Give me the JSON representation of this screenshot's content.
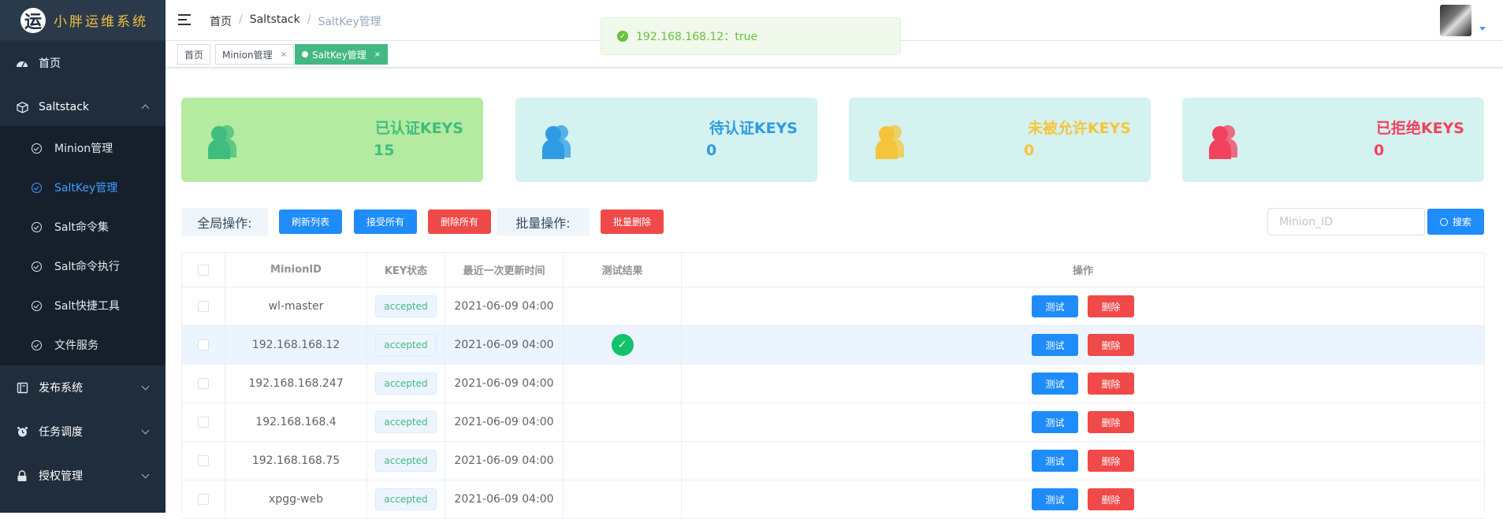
{
  "app": {
    "logo_char": "运",
    "logo_text": "小胖运维系统"
  },
  "sidebar": {
    "items": [
      {
        "label": "首页",
        "icon": "dashboard-icon"
      },
      {
        "label": "Saltstack",
        "icon": "box-icon"
      },
      {
        "label": "发布系统",
        "icon": "book-icon"
      },
      {
        "label": "任务调度",
        "icon": "alarm-icon"
      },
      {
        "label": "授权管理",
        "icon": "lock-icon"
      }
    ],
    "submenu": [
      {
        "label": "Minion管理"
      },
      {
        "label": "SaltKey管理",
        "active": true
      },
      {
        "label": "Salt命令集"
      },
      {
        "label": "Salt命令执行"
      },
      {
        "label": "Salt快捷工具"
      },
      {
        "label": "文件服务"
      }
    ]
  },
  "header": {
    "breadcrumb": [
      "首页",
      "Saltstack",
      "SaltKey管理"
    ]
  },
  "tags": [
    {
      "label": "首页"
    },
    {
      "label": "Minion管理",
      "close": "×"
    },
    {
      "label": "SaltKey管理",
      "close": "×",
      "active": true
    }
  ],
  "toast": {
    "message": "192.168.168.12：true",
    "color": "#67c23a"
  },
  "cards": [
    {
      "title": "已认证KEYS",
      "value": "15",
      "color": "#3fbd7f",
      "bg": "#b4eba0"
    },
    {
      "title": "待认证KEYS",
      "value": "0",
      "color": "#2f9be3",
      "bg": "#d4f2ef"
    },
    {
      "title": "未被允许KEYS",
      "value": "0",
      "color": "#f5c43b",
      "bg": "#d4f2ef"
    },
    {
      "title": "已拒绝KEYS",
      "value": "0",
      "color": "#f2425f",
      "bg": "#d4f2ef"
    }
  ],
  "actions": {
    "global_label": "全局操作:",
    "refresh": "刷新列表",
    "accept_all": "接受所有",
    "delete_all": "删除所有",
    "batch_label": "批量操作:",
    "batch_delete": "批量删除",
    "search_placeholder": "Minion_ID",
    "search_button": "搜索"
  },
  "table": {
    "headers": [
      "MinionID",
      "KEY状态",
      "最近一次更新时间",
      "测试结果",
      "操作"
    ],
    "test_label": "测试",
    "delete_label": "删除",
    "rows": [
      {
        "id": "wl-master",
        "status": "accepted",
        "updated": "2021-06-09 04:00",
        "result": ""
      },
      {
        "id": "192.168.168.12",
        "status": "accepted",
        "updated": "2021-06-09 04:00",
        "result": "success"
      },
      {
        "id": "192.168.168.247",
        "status": "accepted",
        "updated": "2021-06-09 04:00",
        "result": ""
      },
      {
        "id": "192.168.168.4",
        "status": "accepted",
        "updated": "2021-06-09 04:00",
        "result": ""
      },
      {
        "id": "192.168.168.75",
        "status": "accepted",
        "updated": "2021-06-09 04:00",
        "result": ""
      },
      {
        "id": "xpgg-web",
        "status": "accepted",
        "updated": "2021-06-09 04:00",
        "result": ""
      }
    ]
  }
}
